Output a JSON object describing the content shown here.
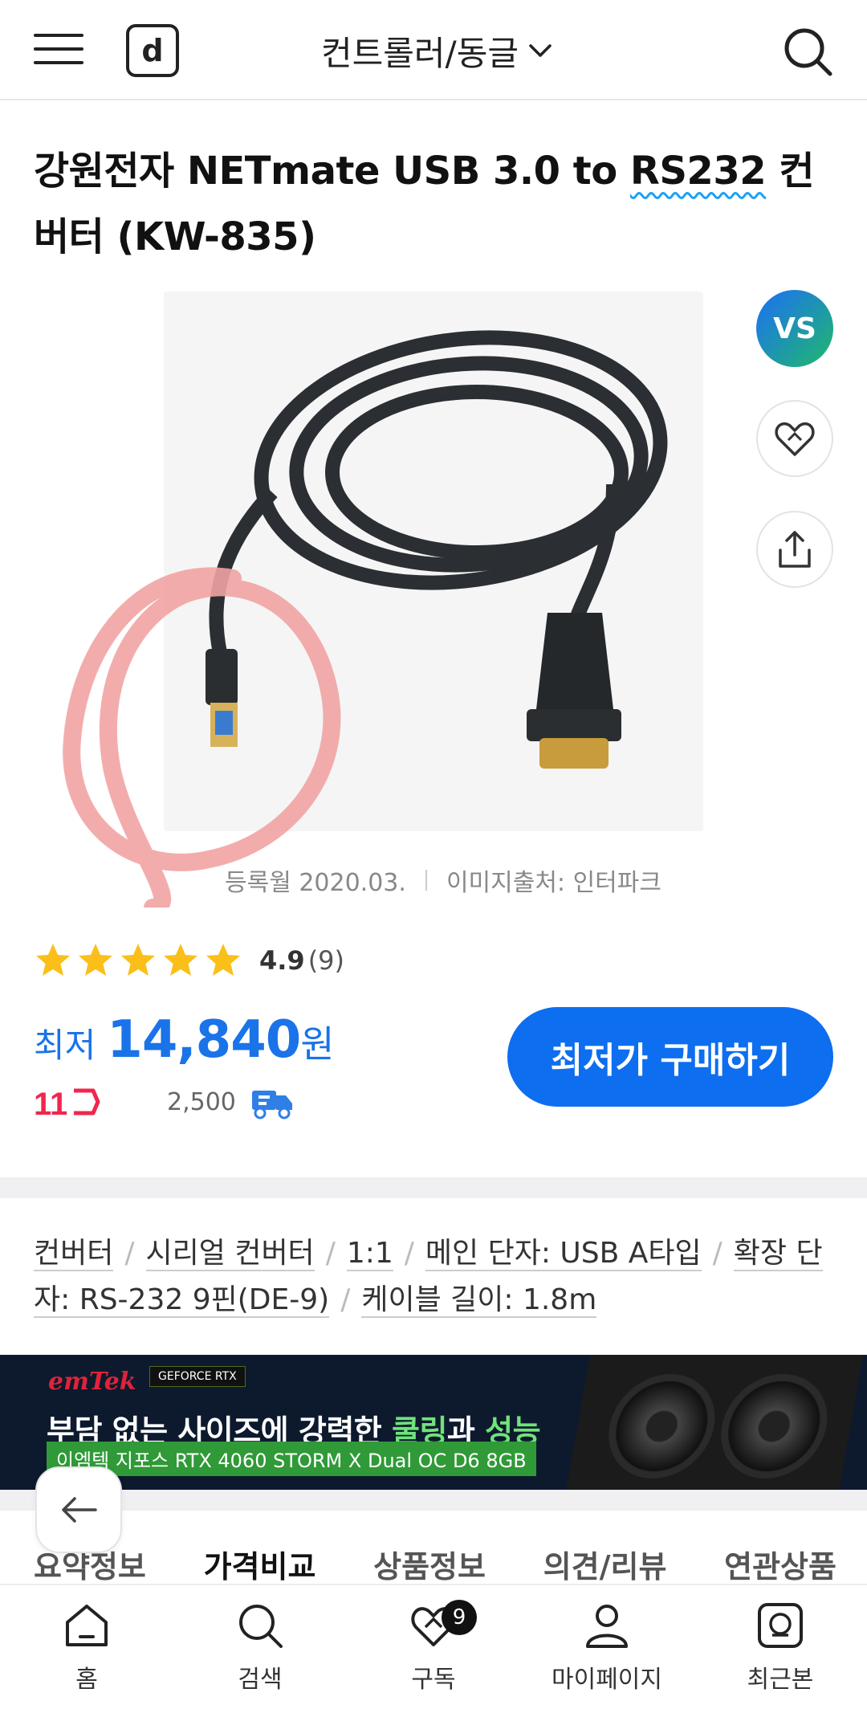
{
  "header": {
    "logo": "d",
    "category": "컨트롤러/동글"
  },
  "product": {
    "title_part1": "강원전자 NETmate USB 3.0 to ",
    "title_highlight": "RS232",
    "title_part2": " 컨버터 (KW-835)",
    "vs_label": "VS",
    "registered": "등록월 2020.03.",
    "image_source": "이미지출처: 인터파크",
    "rating": "4.9",
    "rating_count": "(9)",
    "stars": 5
  },
  "price": {
    "label": "최저",
    "value": "14,840",
    "unit": "원",
    "buy_button": "최저가 구매하기",
    "shop_logo": "11",
    "shipping": "2,500"
  },
  "specs": {
    "tags": [
      "컨버터",
      "시리얼 컨버터",
      "1:1",
      "메인 단자: USB A타입",
      "확장 단자: RS-232 9핀(DE-9)",
      "케이블 길이: 1.8m"
    ]
  },
  "banner": {
    "brand1": "emTek",
    "brand2": "GEFORCE RTX",
    "headline_a": "부담 없는 사이즈에 강력한 ",
    "headline_b": "쿨링",
    "headline_c": "과 ",
    "headline_d": "성능",
    "sub": "이엠텍 지포스 RTX 4060 STORM X Dual OC D6 8GB"
  },
  "tabs": [
    {
      "label": "요약정보"
    },
    {
      "label": "가격비교"
    },
    {
      "label": "상품정보"
    },
    {
      "label": "의견/리뷰"
    },
    {
      "label": "연관상품"
    }
  ],
  "bottom_nav": [
    {
      "label": "홈"
    },
    {
      "label": "검색"
    },
    {
      "label": "구독",
      "badge": "9"
    },
    {
      "label": "마이페이지"
    },
    {
      "label": "최근본"
    }
  ],
  "colors": {
    "accent": "#0d6ef0",
    "price": "#1a73e8",
    "star": "#fbbf1a"
  }
}
